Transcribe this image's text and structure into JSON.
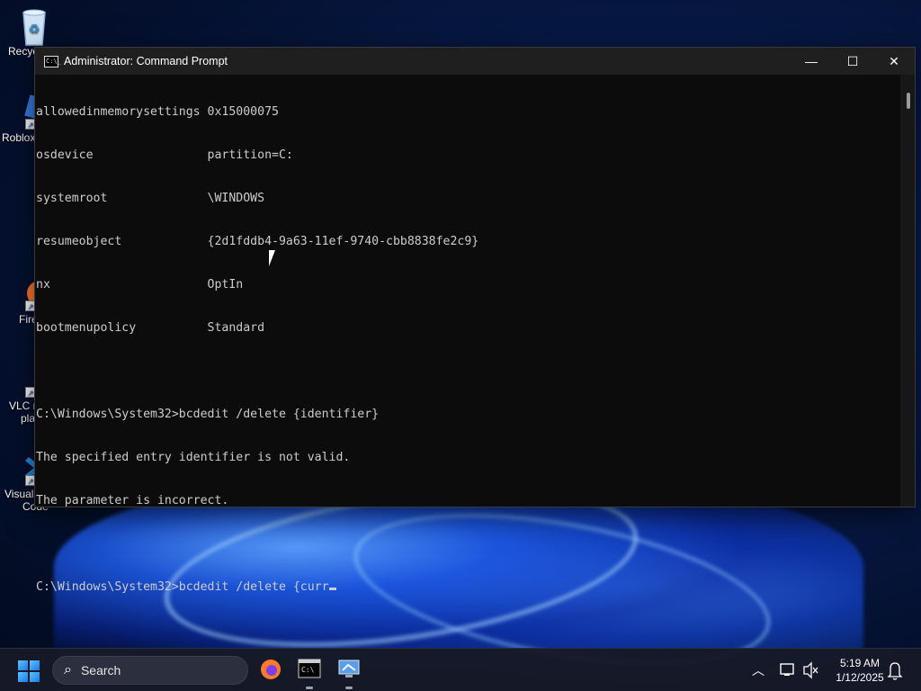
{
  "desktop": {
    "icons": [
      {
        "label": "Recyc"
      },
      {
        "label": "Roblox"
      },
      {
        "label": "Fire"
      },
      {
        "label": "VLC r",
        "label2": "pla"
      },
      {
        "label": "Visual",
        "label2": "Code"
      }
    ]
  },
  "window": {
    "title": "Administrator: Command Prompt",
    "icon_text": "C:\\_",
    "controls": {
      "minimize": "—",
      "maximize": "☐",
      "close": "✕"
    }
  },
  "console": {
    "lines": [
      "allowedinmemorysettings 0x15000075",
      "osdevice                partition=C:",
      "systemroot              \\WINDOWS",
      "resumeobject            {2d1fddb4-9a63-11ef-9740-cbb8838fe2c9}",
      "nx                      OptIn",
      "bootmenupolicy          Standard",
      "",
      "C:\\Windows\\System32>bcdedit /delete {identifier}",
      "The specified entry identifier is not valid.",
      "The parameter is incorrect.",
      "",
      "C:\\Windows\\System32>bcdedit /delete {curr"
    ]
  },
  "taskbar": {
    "search_label": "Search",
    "time": "5:19 AM",
    "date": "1/12/2025"
  },
  "colors": {
    "console_bg": "#0c0c0c",
    "console_fg": "#cccccc",
    "titlebar_bg": "#1f1f1f",
    "taskbar_bg": "#161a28"
  }
}
